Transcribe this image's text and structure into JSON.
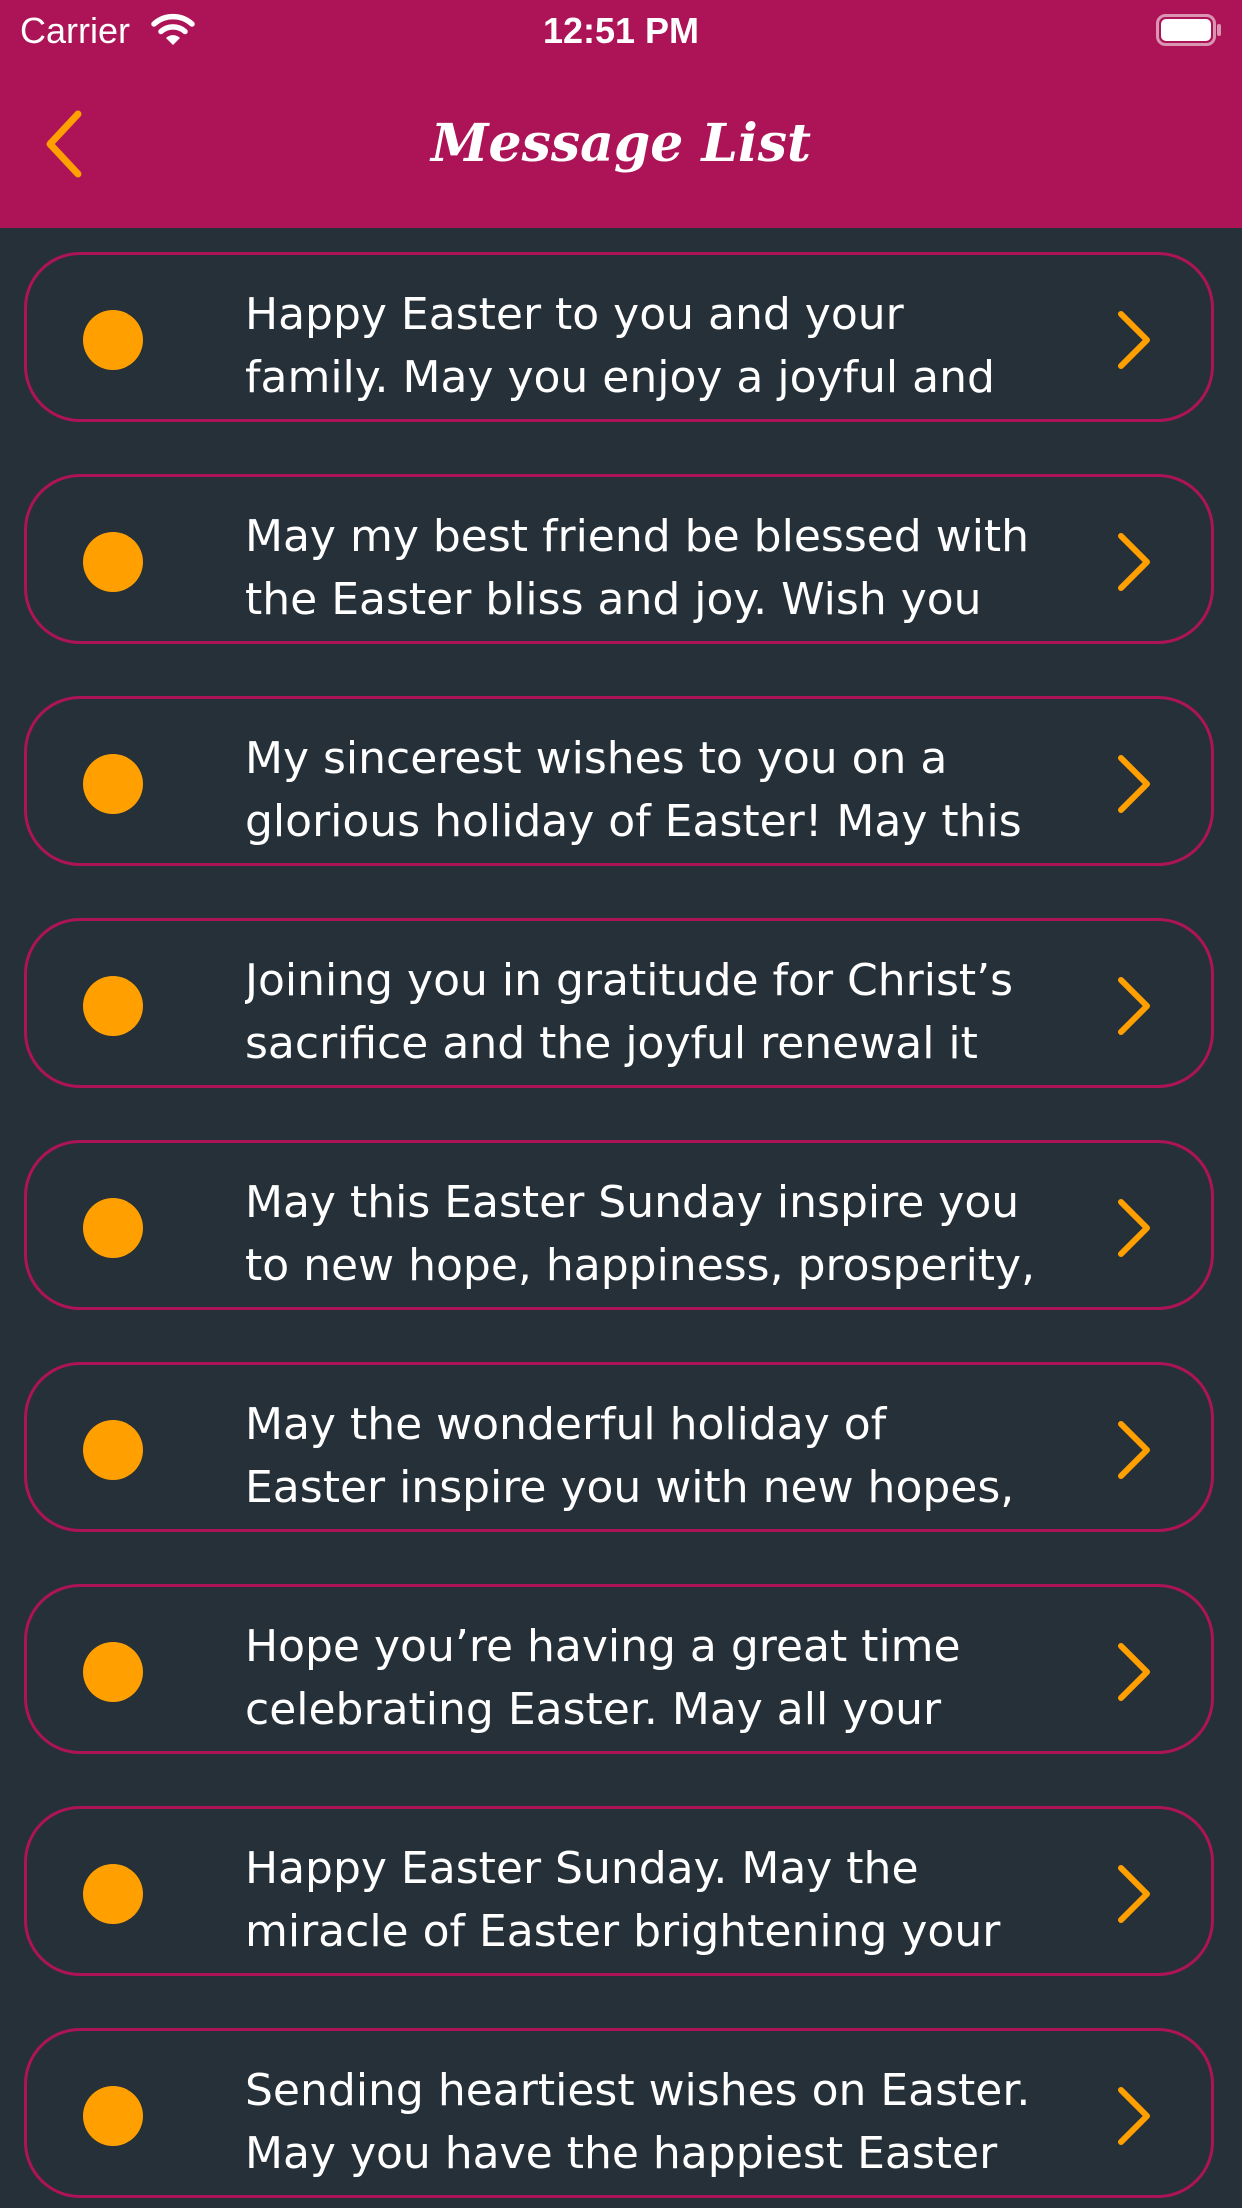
{
  "status_bar": {
    "carrier": "Carrier",
    "time": "12:51 PM",
    "wifi_icon": "wifi-icon",
    "battery_icon": "battery-icon"
  },
  "nav": {
    "title": "Message List",
    "back_icon": "chevron-left-icon",
    "bar_color": "#ad1457",
    "accent_color": "#ffa000"
  },
  "messages": [
    {
      "line1": "Happy Easter to you and your",
      "line2": "family. May you enjoy a joyful and"
    },
    {
      "line1": "May my best friend be blessed with",
      "line2": "the Easter bliss and joy. Wish you"
    },
    {
      "line1": "My sincerest wishes to you on a",
      "line2": "glorious holiday of Easter! May this"
    },
    {
      "line1": "Joining you in gratitude for Christ’s",
      "line2": "sacrifice and the joyful renewal it"
    },
    {
      "line1": "May this Easter Sunday inspire you",
      "line2": "to new hope, happiness, prosperity,"
    },
    {
      "line1": "May the wonderful holiday of",
      "line2": "Easter inspire you with new hopes,"
    },
    {
      "line1": "Hope you’re having a great time",
      "line2": "celebrating Easter. May all your"
    },
    {
      "line1": "Happy Easter Sunday. May the",
      "line2": "miracle of Easter brightening your"
    },
    {
      "line1": "Sending heartiest wishes on Easter.",
      "line2": "May you have the happiest Easter"
    }
  ]
}
